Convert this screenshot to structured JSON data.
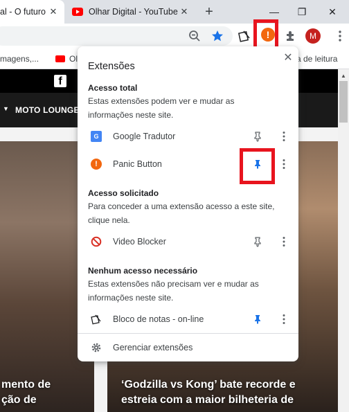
{
  "tabs": [
    {
      "title": "al - O futuro",
      "active": true
    },
    {
      "title": "Olhar Digital - YouTube",
      "active": false
    }
  ],
  "window": {
    "new_tab": "+",
    "minimize": "—",
    "restore": "❐",
    "close": "✕"
  },
  "toolbar": {
    "avatar_letter": "M",
    "ext_alert_symbol": "!"
  },
  "bookmarks": {
    "item1": "magens,...",
    "item2": "Ol",
    "item3": "a de leitura"
  },
  "site": {
    "facebook": "f",
    "nav_label": "MOTO LOUNGE"
  },
  "cards": {
    "left_title_1": "mento de",
    "left_title_2": "ção de",
    "right_title_1": "‘Godzilla vs Kong’ bate recorde e",
    "right_title_2": "estreia com a maior bilheteria de"
  },
  "popup": {
    "title": "Extensões",
    "close": "✕",
    "sections": [
      {
        "heading": "Acesso total",
        "description": "Estas extensões podem ver e mudar as informações neste site.",
        "items": [
          {
            "name": "Google Tradutor",
            "pinned": false,
            "icon": "google-translate-icon"
          },
          {
            "name": "Panic Button",
            "pinned": true,
            "icon": "panic-button-icon"
          }
        ]
      },
      {
        "heading": "Acesso solicitado",
        "description": "Para conceder a uma extensão acesso a este site, clique nela.",
        "items": [
          {
            "name": "Video Blocker",
            "pinned": false,
            "icon": "video-blocker-icon"
          }
        ]
      },
      {
        "heading": "Nenhum acesso necessário",
        "description": "Estas extensões não precisam ver e mudar as informações neste site.",
        "items": [
          {
            "name": "Bloco de notas - on-line",
            "pinned": true,
            "icon": "notepad-icon"
          }
        ]
      }
    ],
    "manage": "Gerenciar extensões"
  },
  "colors": {
    "pin_active": "#1a73e8",
    "pin_inactive": "#5f6368",
    "highlight": "#e8141e",
    "panic_orange": "#f2670f"
  }
}
